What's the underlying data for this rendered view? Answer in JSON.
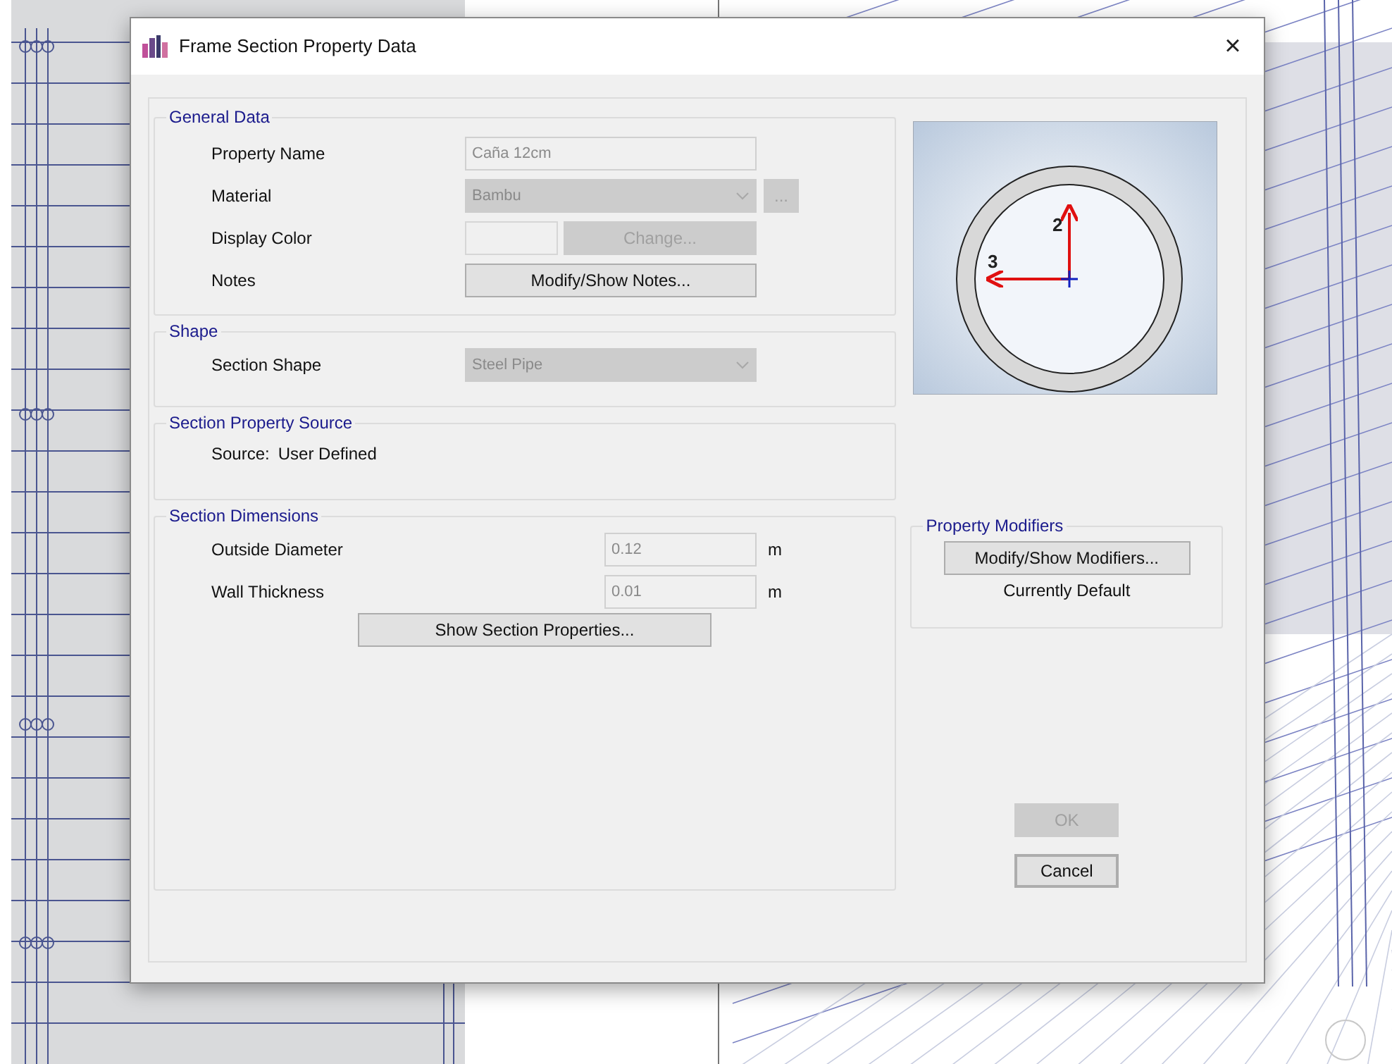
{
  "window": {
    "title": "Frame Section Property Data",
    "close": "×"
  },
  "general_data": {
    "title": "General Data",
    "rows": [
      {
        "kind": "text",
        "label": "Property Name",
        "value": "Caña 12cm",
        "disabled": true
      },
      {
        "kind": "dropdown",
        "label": "Material",
        "value": "Bambu",
        "disabled": true,
        "button": {
          "label": "...",
          "disabled": true
        }
      },
      {
        "kind": "color",
        "label": "Display Color",
        "button": {
          "label": "Change...",
          "disabled": true
        }
      },
      {
        "kind": "button",
        "label": "Notes",
        "button": {
          "label": "Modify/Show Notes...",
          "disabled": false
        }
      }
    ]
  },
  "shape": {
    "title": "Shape",
    "rows": [
      {
        "kind": "dropdown",
        "label": "Section Shape",
        "value": "Steel Pipe",
        "disabled": true
      }
    ]
  },
  "property_source": {
    "title": "Section Property Source",
    "label": "Source:",
    "value": "User Defined"
  },
  "dimensions": {
    "title": "Section Dimensions",
    "rows": [
      {
        "label": "Outside Diameter",
        "value": "0.12",
        "unit": "m",
        "disabled": true
      },
      {
        "label": "Wall Thickness",
        "value": "0.01",
        "unit": "m",
        "disabled": true
      }
    ],
    "button": {
      "label": "Show Section Properties...",
      "disabled": false
    }
  },
  "preview": {
    "axis_labels": [
      "2",
      "3"
    ]
  },
  "property_modifiers": {
    "title": "Property Modifiers",
    "button": {
      "label": "Modify/Show Modifiers...",
      "disabled": false
    },
    "status": "Currently Default"
  },
  "buttons": [
    {
      "label": "OK",
      "disabled": true,
      "focused": false
    },
    {
      "label": "Cancel",
      "disabled": false,
      "focused": true
    }
  ]
}
